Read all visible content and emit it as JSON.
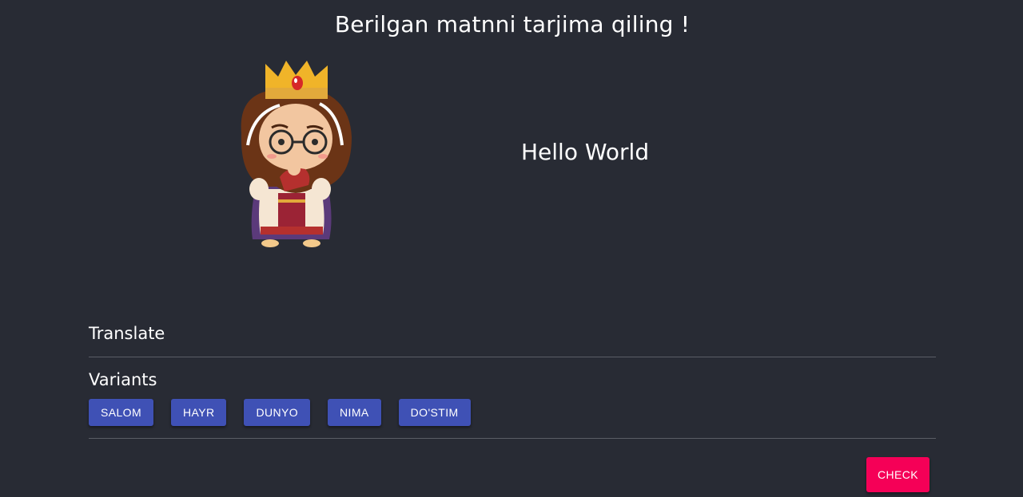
{
  "header": {
    "title": "Berilgan matnni tarjima qiling !"
  },
  "character": {
    "icon": "king-character-icon"
  },
  "exercise": {
    "phrase": "Hello World"
  },
  "sections": {
    "translate_label": "Translate",
    "variants_label": "Variants"
  },
  "variants": [
    {
      "label": "SALOM"
    },
    {
      "label": "HAYR"
    },
    {
      "label": "DUNYO"
    },
    {
      "label": "NIMA"
    },
    {
      "label": "DO'STIM"
    }
  ],
  "actions": {
    "check_label": "CHECK"
  },
  "colors": {
    "background": "#282b34",
    "variant_button": "#3f51b5",
    "check_button": "#f50057",
    "divider": "#5b5e66"
  }
}
